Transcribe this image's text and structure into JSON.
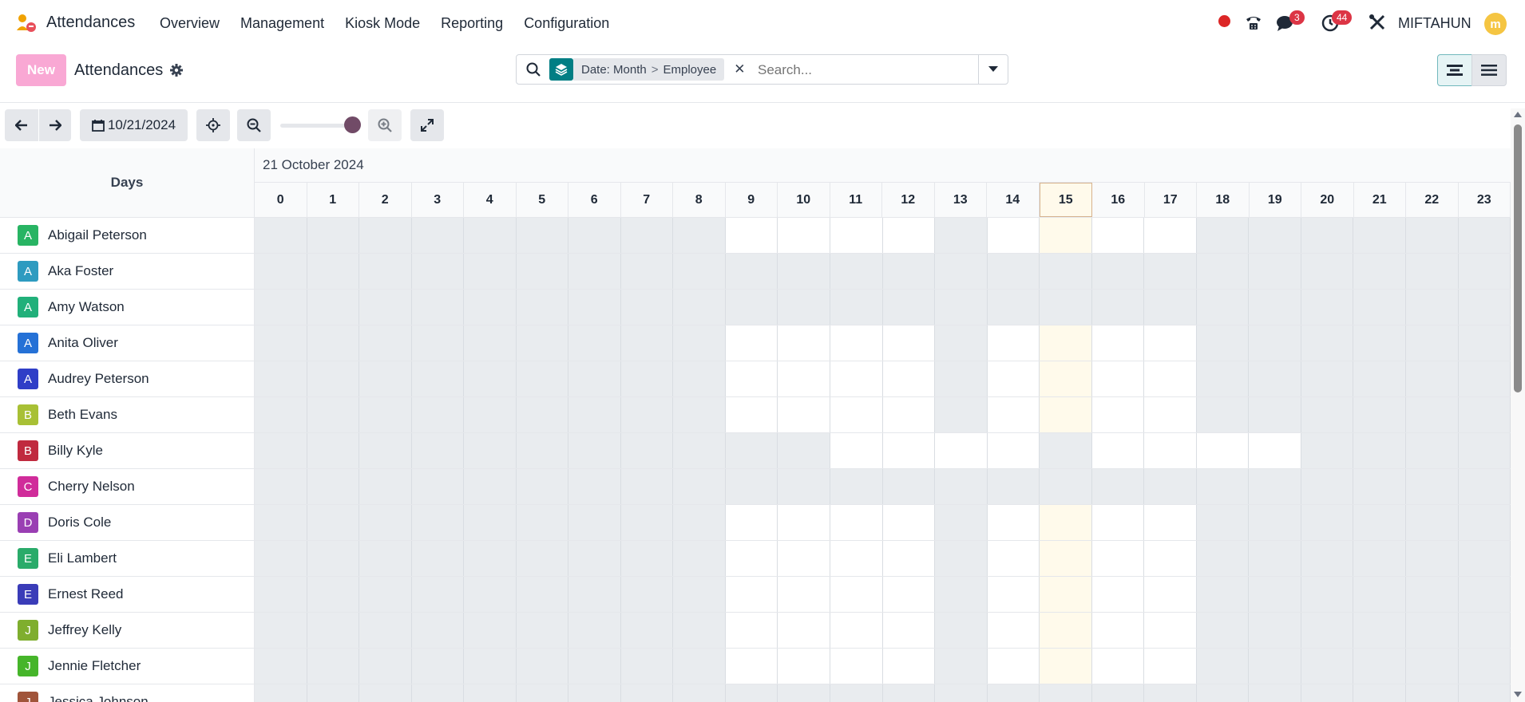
{
  "app": {
    "name": "Attendances",
    "menu": [
      "Overview",
      "Management",
      "Kiosk Mode",
      "Reporting",
      "Configuration"
    ],
    "chat_badge": "3",
    "activity_badge": "44",
    "user_name": "MIFTAHUN",
    "user_initial": "m"
  },
  "control": {
    "new_label": "New",
    "title": "Attendances",
    "facet_label": "Date: Month",
    "facet_sep": ">",
    "facet_value": "Employee",
    "search_placeholder": "Search..."
  },
  "toolbar": {
    "date": "10/21/2024",
    "zoom_level": 1.0
  },
  "gantt": {
    "rows_header": "Days",
    "date_header": "21 October 2024",
    "hours": [
      "0",
      "1",
      "2",
      "3",
      "4",
      "5",
      "6",
      "7",
      "8",
      "9",
      "10",
      "11",
      "12",
      "13",
      "14",
      "15",
      "16",
      "17",
      "18",
      "19",
      "20",
      "21",
      "22",
      "23"
    ],
    "current_hour": "15",
    "rows": [
      {
        "name": "Abigail Peterson",
        "initial": "A",
        "color": "#28b463",
        "work": [
          9,
          10,
          11,
          12,
          14,
          15,
          16,
          17
        ]
      },
      {
        "name": "Aka Foster",
        "initial": "A",
        "color": "#2e9bc0",
        "work": []
      },
      {
        "name": "Amy Watson",
        "initial": "A",
        "color": "#21b07a",
        "work": []
      },
      {
        "name": "Anita Oliver",
        "initial": "A",
        "color": "#2571d6",
        "work": [
          9,
          10,
          11,
          12,
          14,
          15,
          16,
          17
        ]
      },
      {
        "name": "Audrey Peterson",
        "initial": "A",
        "color": "#2f3ec7",
        "work": [
          9,
          10,
          11,
          12,
          14,
          15,
          16,
          17
        ]
      },
      {
        "name": "Beth Evans",
        "initial": "B",
        "color": "#a8c035",
        "work": [
          9,
          10,
          11,
          12,
          14,
          15,
          16,
          17
        ]
      },
      {
        "name": "Billy Kyle",
        "initial": "B",
        "color": "#c02a3f",
        "work": [
          11,
          12,
          13,
          14,
          16,
          17,
          18,
          19
        ]
      },
      {
        "name": "Cherry Nelson",
        "initial": "C",
        "color": "#d02c9a",
        "work": []
      },
      {
        "name": "Doris Cole",
        "initial": "D",
        "color": "#9a3fb3",
        "work": [
          9,
          10,
          11,
          12,
          14,
          15,
          16,
          17
        ]
      },
      {
        "name": "Eli Lambert",
        "initial": "E",
        "color": "#2aab6a",
        "work": [
          9,
          10,
          11,
          12,
          14,
          15,
          16,
          17
        ]
      },
      {
        "name": "Ernest Reed",
        "initial": "E",
        "color": "#3a3cb8",
        "work": [
          9,
          10,
          11,
          12,
          14,
          15,
          16,
          17
        ]
      },
      {
        "name": "Jeffrey Kelly",
        "initial": "J",
        "color": "#7fae2e",
        "work": [
          9,
          10,
          11,
          12,
          14,
          15,
          16,
          17
        ]
      },
      {
        "name": "Jennie Fletcher",
        "initial": "J",
        "color": "#46b52a",
        "work": [
          9,
          10,
          11,
          12,
          14,
          15,
          16,
          17
        ]
      },
      {
        "name": "Jessica Johnson",
        "initial": "J",
        "color": "#a0543a",
        "work": []
      }
    ]
  }
}
